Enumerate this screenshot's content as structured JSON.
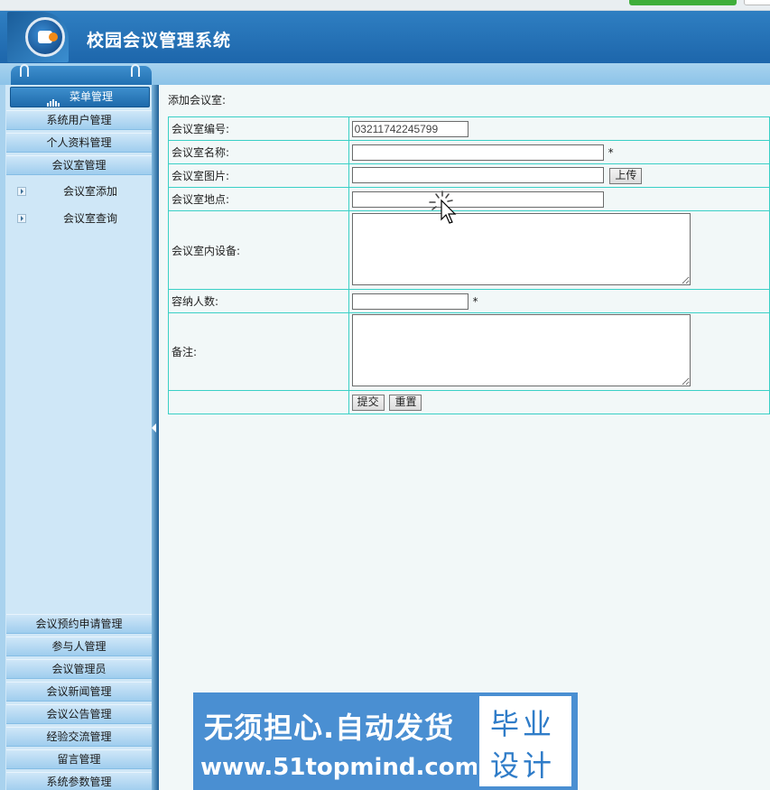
{
  "header": {
    "title": "校园会议管理系统"
  },
  "sidebar": {
    "menu_title": "菜单管理",
    "top_items": [
      "系统用户管理",
      "个人资料管理",
      "会议室管理"
    ],
    "sub_items": [
      "会议室添加",
      "会议室查询"
    ],
    "bottom_items": [
      "会议预约申请管理",
      "参与人管理",
      "会议管理员",
      "会议新闻管理",
      "会议公告管理",
      "经验交流管理",
      "留言管理",
      "系统参数管理"
    ]
  },
  "form": {
    "caption": "添加会议室:",
    "labels": {
      "room_no": "会议室编号:",
      "room_name": "会议室名称:",
      "room_image": "会议室图片:",
      "room_location": "会议室地点:",
      "room_equipment": "会议室内设备:",
      "capacity": "容纳人数:",
      "remark": "备注:"
    },
    "values": {
      "room_no": "03211742245799",
      "room_name": "",
      "room_image": "",
      "room_location": "",
      "room_equipment": "",
      "capacity": "",
      "remark": ""
    },
    "required_mark": "*",
    "upload_label": "上传",
    "submit_label": "提交",
    "reset_label": "重置"
  },
  "banner": {
    "line1": "无须担心.自动发货",
    "line2": "www.51topmind.com",
    "box_line1": "毕业",
    "box_line2": "设计"
  },
  "colors": {
    "header_blue": "#2271b5",
    "table_border": "#3ad0c6",
    "sidebar_bg": "#cfe7f7",
    "banner_blue": "#4a8fd2"
  }
}
